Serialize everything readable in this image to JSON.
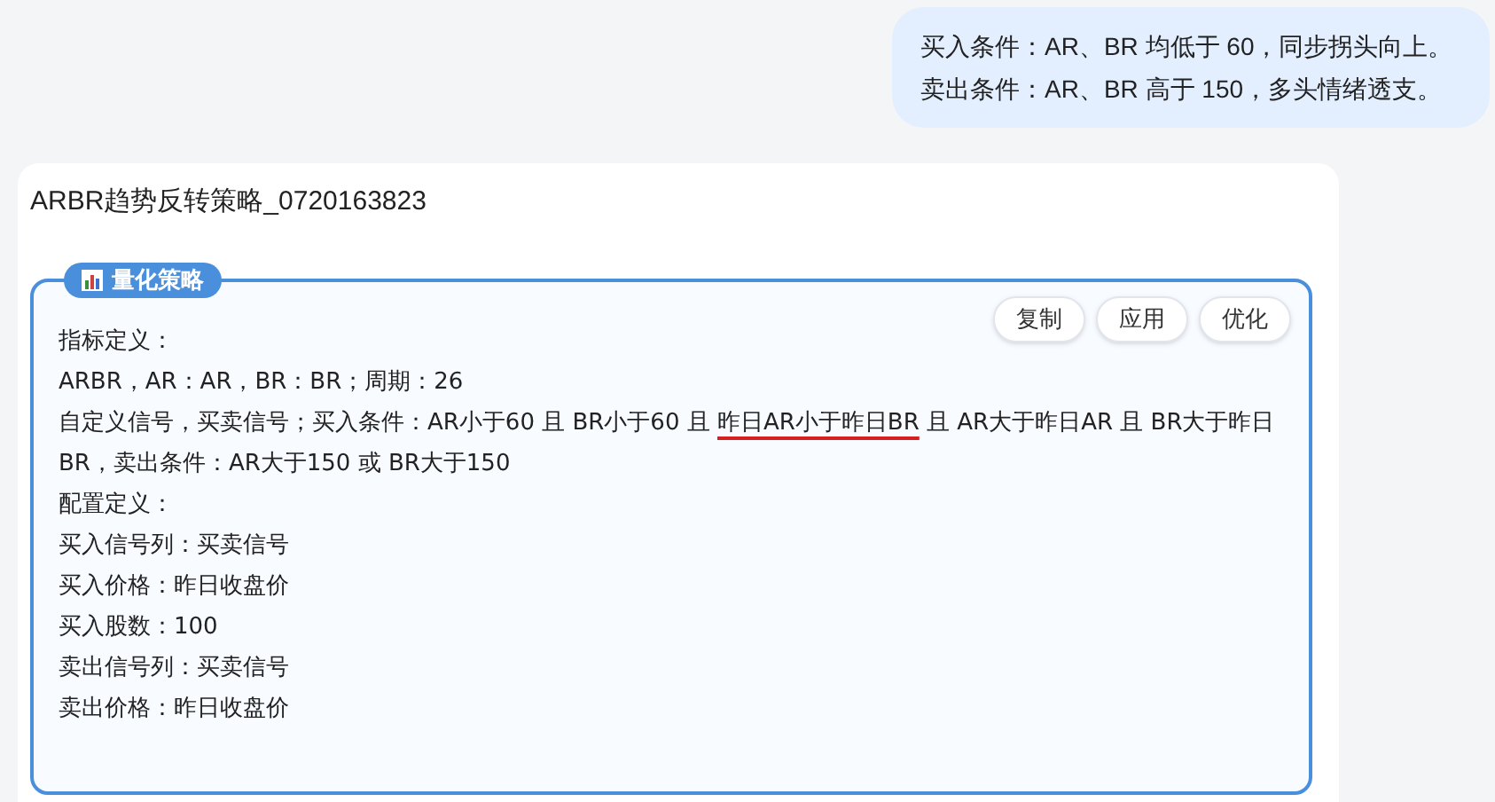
{
  "user_message": {
    "lines": [
      "买入条件：AR、BR 均低于 60，同步拐头向上。",
      "卖出条件：AR、BR 高于 150，多头情绪透支。"
    ]
  },
  "reply": {
    "title": "ARBR趋势反转策略_0720163823",
    "strategy": {
      "badge": "量化策略",
      "actions": [
        "复制",
        "应用",
        "优化"
      ],
      "lines": [
        {
          "segments": [
            {
              "text": "指标定义：",
              "marked": false
            }
          ]
        },
        {
          "segments": [
            {
              "text": "ARBR，AR：AR，BR：BR；周期：26",
              "marked": false
            }
          ]
        },
        {
          "segments": [
            {
              "text": "自定义信号，买卖信号；买入条件：AR小于60 且 BR小于60 且 ",
              "marked": false
            },
            {
              "text": "昨日AR小于昨日BR",
              "marked": true
            },
            {
              "text": " 且 AR大于昨日AR 且 BR大于昨日BR，卖出条件：AR大于150 或 BR大于150",
              "marked": false
            }
          ]
        },
        {
          "segments": [
            {
              "text": "配置定义：",
              "marked": false
            }
          ]
        },
        {
          "segments": [
            {
              "text": "买入信号列：买卖信号",
              "marked": false
            }
          ]
        },
        {
          "segments": [
            {
              "text": "买入价格：昨日收盘价",
              "marked": false
            }
          ]
        },
        {
          "segments": [
            {
              "text": "买入股数：100",
              "marked": false
            }
          ]
        },
        {
          "segments": [
            {
              "text": "卖出信号列：买卖信号",
              "marked": false
            }
          ]
        },
        {
          "segments": [
            {
              "text": "卖出价格：昨日收盘价",
              "marked": false
            }
          ]
        }
      ]
    }
  }
}
